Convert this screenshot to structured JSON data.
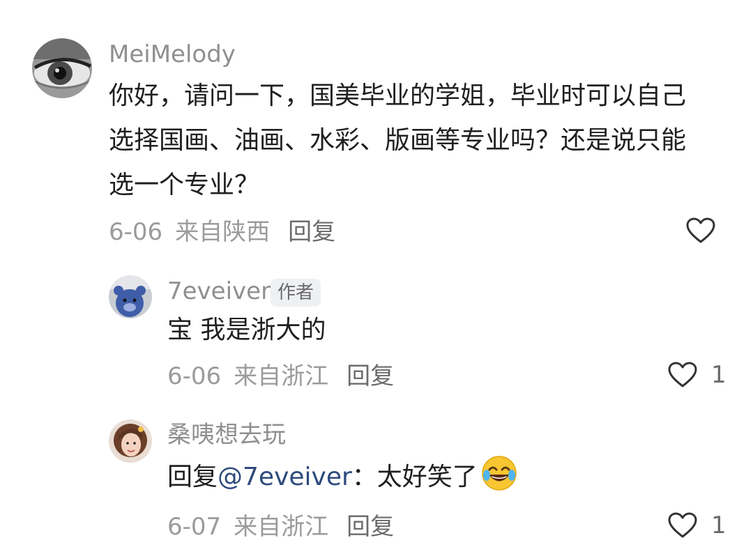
{
  "comments": [
    {
      "username": "MeiMelody",
      "text": "你好，请问一下，国美毕业的学姐，毕业时可以自己选择国画、油画、水彩、版画等专业吗？还是说只能选一个专业？",
      "date": "6-06",
      "location": "来自陕西",
      "reply_label": "回复",
      "avatar_icon": "eye-photo-avatar",
      "like_icon": "heart-outline-icon"
    },
    {
      "username": "7eveiver",
      "badge": "作者",
      "text": "宝 我是浙大的",
      "date": "6-06",
      "location": "来自浙江",
      "reply_label": "回复",
      "like_count": "1",
      "avatar_icon": "blue-bear-avatar",
      "like_icon": "heart-outline-icon"
    },
    {
      "username": "桑咦想去玩",
      "text_prefix": "回复",
      "mention": "@7eveiver",
      "text_suffix": "：太好笑了",
      "emoji": "tears-of-joy-emoji",
      "date": "6-07",
      "location": "来自浙江",
      "reply_label": "回复",
      "like_count": "1",
      "avatar_icon": "girl-photo-avatar",
      "like_icon": "heart-outline-icon"
    }
  ],
  "colors": {
    "username": "#8f8f8f",
    "body": "#1f1f1f",
    "meta": "#9b9b9b",
    "mention": "#2d4a7c",
    "badge_bg": "#eef0f3"
  }
}
